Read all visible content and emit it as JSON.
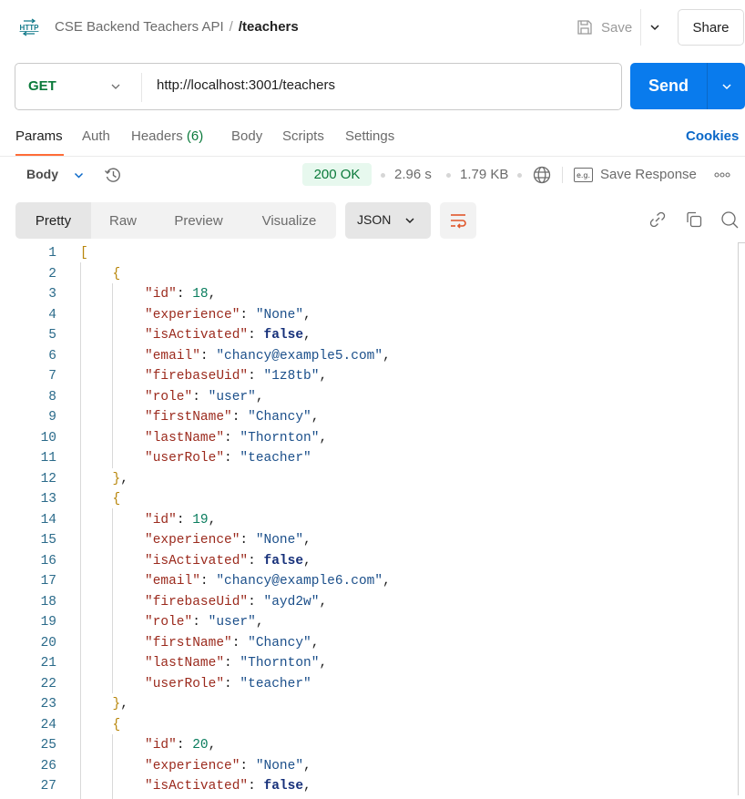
{
  "header": {
    "icon": "http-icon",
    "collection": "CSE Backend Teachers API",
    "separator": "/",
    "request_name": "/teachers",
    "save_label": "Save",
    "share_label": "Share"
  },
  "request": {
    "method": "GET",
    "method_color": "#0b7a3b",
    "url": "http://localhost:3001/teachers",
    "send_label": "Send",
    "send_color": "#097bed"
  },
  "request_tabs": {
    "items": [
      {
        "label": "Params",
        "active": true
      },
      {
        "label": "Auth"
      },
      {
        "label": "Headers",
        "count": "(6)"
      },
      {
        "label": "Body"
      },
      {
        "label": "Scripts"
      },
      {
        "label": "Settings"
      }
    ],
    "cookies_label": "Cookies"
  },
  "response": {
    "section_label": "Body",
    "status": "200 OK",
    "time": "2.96 s",
    "size": "1.79 KB",
    "save_response_label": "Save Response",
    "eg_label": "e.g.",
    "view_tabs": [
      "Pretty",
      "Raw",
      "Preview",
      "Visualize"
    ],
    "active_view": "Pretty",
    "format": "JSON"
  },
  "code_lines": [
    {
      "n": "1",
      "indent": 0,
      "tokens": [
        {
          "t": "[",
          "c": "br"
        }
      ]
    },
    {
      "n": "2",
      "indent": 1,
      "tokens": [
        {
          "t": "{",
          "c": "br"
        }
      ]
    },
    {
      "n": "3",
      "indent": 2,
      "tokens": [
        {
          "t": "\"id\"",
          "c": "k"
        },
        {
          "t": ": ",
          "c": "p"
        },
        {
          "t": "18",
          "c": "n"
        },
        {
          "t": ",",
          "c": "p"
        }
      ]
    },
    {
      "n": "4",
      "indent": 2,
      "tokens": [
        {
          "t": "\"experience\"",
          "c": "k"
        },
        {
          "t": ": ",
          "c": "p"
        },
        {
          "t": "\"None\"",
          "c": "s"
        },
        {
          "t": ",",
          "c": "p"
        }
      ]
    },
    {
      "n": "5",
      "indent": 2,
      "tokens": [
        {
          "t": "\"isActivated\"",
          "c": "k"
        },
        {
          "t": ": ",
          "c": "p"
        },
        {
          "t": "false",
          "c": "b"
        },
        {
          "t": ",",
          "c": "p"
        }
      ]
    },
    {
      "n": "6",
      "indent": 2,
      "tokens": [
        {
          "t": "\"email\"",
          "c": "k"
        },
        {
          "t": ": ",
          "c": "p"
        },
        {
          "t": "\"chancy@example5.com\"",
          "c": "s"
        },
        {
          "t": ",",
          "c": "p"
        }
      ]
    },
    {
      "n": "7",
      "indent": 2,
      "tokens": [
        {
          "t": "\"firebaseUid\"",
          "c": "k"
        },
        {
          "t": ": ",
          "c": "p"
        },
        {
          "t": "\"1z8tb\"",
          "c": "s"
        },
        {
          "t": ",",
          "c": "p"
        }
      ]
    },
    {
      "n": "8",
      "indent": 2,
      "tokens": [
        {
          "t": "\"role\"",
          "c": "k"
        },
        {
          "t": ": ",
          "c": "p"
        },
        {
          "t": "\"user\"",
          "c": "s"
        },
        {
          "t": ",",
          "c": "p"
        }
      ]
    },
    {
      "n": "9",
      "indent": 2,
      "tokens": [
        {
          "t": "\"firstName\"",
          "c": "k"
        },
        {
          "t": ": ",
          "c": "p"
        },
        {
          "t": "\"Chancy\"",
          "c": "s"
        },
        {
          "t": ",",
          "c": "p"
        }
      ]
    },
    {
      "n": "10",
      "indent": 2,
      "tokens": [
        {
          "t": "\"lastName\"",
          "c": "k"
        },
        {
          "t": ": ",
          "c": "p"
        },
        {
          "t": "\"Thornton\"",
          "c": "s"
        },
        {
          "t": ",",
          "c": "p"
        }
      ]
    },
    {
      "n": "11",
      "indent": 2,
      "tokens": [
        {
          "t": "\"userRole\"",
          "c": "k"
        },
        {
          "t": ": ",
          "c": "p"
        },
        {
          "t": "\"teacher\"",
          "c": "s"
        }
      ]
    },
    {
      "n": "12",
      "indent": 1,
      "tokens": [
        {
          "t": "}",
          "c": "br"
        },
        {
          "t": ",",
          "c": "p"
        }
      ]
    },
    {
      "n": "13",
      "indent": 1,
      "tokens": [
        {
          "t": "{",
          "c": "br"
        }
      ]
    },
    {
      "n": "14",
      "indent": 2,
      "tokens": [
        {
          "t": "\"id\"",
          "c": "k"
        },
        {
          "t": ": ",
          "c": "p"
        },
        {
          "t": "19",
          "c": "n"
        },
        {
          "t": ",",
          "c": "p"
        }
      ]
    },
    {
      "n": "15",
      "indent": 2,
      "tokens": [
        {
          "t": "\"experience\"",
          "c": "k"
        },
        {
          "t": ": ",
          "c": "p"
        },
        {
          "t": "\"None\"",
          "c": "s"
        },
        {
          "t": ",",
          "c": "p"
        }
      ]
    },
    {
      "n": "16",
      "indent": 2,
      "tokens": [
        {
          "t": "\"isActivated\"",
          "c": "k"
        },
        {
          "t": ": ",
          "c": "p"
        },
        {
          "t": "false",
          "c": "b"
        },
        {
          "t": ",",
          "c": "p"
        }
      ]
    },
    {
      "n": "17",
      "indent": 2,
      "tokens": [
        {
          "t": "\"email\"",
          "c": "k"
        },
        {
          "t": ": ",
          "c": "p"
        },
        {
          "t": "\"chancy@example6.com\"",
          "c": "s"
        },
        {
          "t": ",",
          "c": "p"
        }
      ]
    },
    {
      "n": "18",
      "indent": 2,
      "tokens": [
        {
          "t": "\"firebaseUid\"",
          "c": "k"
        },
        {
          "t": ": ",
          "c": "p"
        },
        {
          "t": "\"ayd2w\"",
          "c": "s"
        },
        {
          "t": ",",
          "c": "p"
        }
      ]
    },
    {
      "n": "19",
      "indent": 2,
      "tokens": [
        {
          "t": "\"role\"",
          "c": "k"
        },
        {
          "t": ": ",
          "c": "p"
        },
        {
          "t": "\"user\"",
          "c": "s"
        },
        {
          "t": ",",
          "c": "p"
        }
      ]
    },
    {
      "n": "20",
      "indent": 2,
      "tokens": [
        {
          "t": "\"firstName\"",
          "c": "k"
        },
        {
          "t": ": ",
          "c": "p"
        },
        {
          "t": "\"Chancy\"",
          "c": "s"
        },
        {
          "t": ",",
          "c": "p"
        }
      ]
    },
    {
      "n": "21",
      "indent": 2,
      "tokens": [
        {
          "t": "\"lastName\"",
          "c": "k"
        },
        {
          "t": ": ",
          "c": "p"
        },
        {
          "t": "\"Thornton\"",
          "c": "s"
        },
        {
          "t": ",",
          "c": "p"
        }
      ]
    },
    {
      "n": "22",
      "indent": 2,
      "tokens": [
        {
          "t": "\"userRole\"",
          "c": "k"
        },
        {
          "t": ": ",
          "c": "p"
        },
        {
          "t": "\"teacher\"",
          "c": "s"
        }
      ]
    },
    {
      "n": "23",
      "indent": 1,
      "tokens": [
        {
          "t": "}",
          "c": "br"
        },
        {
          "t": ",",
          "c": "p"
        }
      ]
    },
    {
      "n": "24",
      "indent": 1,
      "tokens": [
        {
          "t": "{",
          "c": "br"
        }
      ]
    },
    {
      "n": "25",
      "indent": 2,
      "tokens": [
        {
          "t": "\"id\"",
          "c": "k"
        },
        {
          "t": ": ",
          "c": "p"
        },
        {
          "t": "20",
          "c": "n"
        },
        {
          "t": ",",
          "c": "p"
        }
      ]
    },
    {
      "n": "26",
      "indent": 2,
      "tokens": [
        {
          "t": "\"experience\"",
          "c": "k"
        },
        {
          "t": ": ",
          "c": "p"
        },
        {
          "t": "\"None\"",
          "c": "s"
        },
        {
          "t": ",",
          "c": "p"
        }
      ]
    },
    {
      "n": "27",
      "indent": 2,
      "tokens": [
        {
          "t": "\"isActivated\"",
          "c": "k"
        },
        {
          "t": ": ",
          "c": "p"
        },
        {
          "t": "false",
          "c": "b"
        },
        {
          "t": ",",
          "c": "p"
        }
      ]
    }
  ]
}
